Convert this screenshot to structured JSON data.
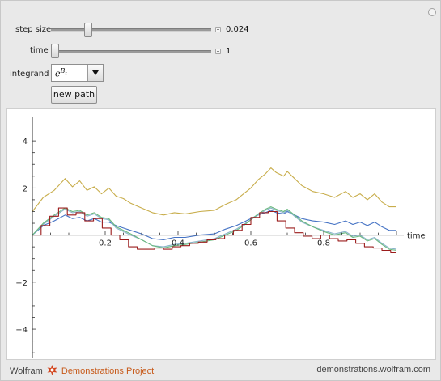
{
  "controls": {
    "step_size": {
      "label": "step size",
      "value": "0.024",
      "fraction": 0.22
    },
    "time": {
      "label": "time",
      "value": "1",
      "fraction": 0.0
    },
    "integrand": {
      "label": "integrand",
      "selected": "e^{B_t}",
      "base": "e",
      "sup": "B",
      "sub": "t"
    },
    "new_path_label": "new path"
  },
  "footer": {
    "brand": "Wolfram",
    "project": "Demonstrations Project",
    "url": "demonstrations.wolfram.com"
  },
  "chart_data": {
    "type": "line",
    "xlabel": "time",
    "ylabel": "",
    "xlim": [
      0,
      1.02
    ],
    "ylim": [
      -5.2,
      5.0
    ],
    "xticks": [
      0.2,
      0.4,
      0.6,
      0.8
    ],
    "yticks": [
      -4,
      -2,
      2,
      4
    ],
    "series": [
      {
        "color": "#c8ad4b",
        "step": false,
        "points": [
          [
            0,
            1.0
          ],
          [
            0.03,
            1.6
          ],
          [
            0.06,
            1.9
          ],
          [
            0.09,
            2.4
          ],
          [
            0.11,
            2.05
          ],
          [
            0.13,
            2.3
          ],
          [
            0.15,
            1.9
          ],
          [
            0.17,
            2.05
          ],
          [
            0.19,
            1.75
          ],
          [
            0.21,
            2.0
          ],
          [
            0.23,
            1.65
          ],
          [
            0.25,
            1.55
          ],
          [
            0.27,
            1.35
          ],
          [
            0.3,
            1.15
          ],
          [
            0.33,
            0.95
          ],
          [
            0.36,
            0.85
          ],
          [
            0.39,
            0.95
          ],
          [
            0.42,
            0.9
          ],
          [
            0.46,
            1.0
          ],
          [
            0.5,
            1.05
          ],
          [
            0.53,
            1.3
          ],
          [
            0.56,
            1.5
          ],
          [
            0.58,
            1.75
          ],
          [
            0.6,
            2.0
          ],
          [
            0.62,
            2.35
          ],
          [
            0.64,
            2.6
          ],
          [
            0.655,
            2.85
          ],
          [
            0.67,
            2.65
          ],
          [
            0.69,
            2.5
          ],
          [
            0.7,
            2.7
          ],
          [
            0.72,
            2.4
          ],
          [
            0.74,
            2.1
          ],
          [
            0.77,
            1.85
          ],
          [
            0.8,
            1.75
          ],
          [
            0.83,
            1.6
          ],
          [
            0.86,
            1.85
          ],
          [
            0.88,
            1.6
          ],
          [
            0.9,
            1.75
          ],
          [
            0.92,
            1.5
          ],
          [
            0.94,
            1.75
          ],
          [
            0.96,
            1.4
          ],
          [
            0.98,
            1.2
          ],
          [
            1.0,
            1.2
          ]
        ]
      },
      {
        "color": "#4472c4",
        "step": false,
        "points": [
          [
            0,
            0.0
          ],
          [
            0.03,
            0.4
          ],
          [
            0.06,
            0.6
          ],
          [
            0.09,
            0.85
          ],
          [
            0.11,
            0.7
          ],
          [
            0.13,
            0.75
          ],
          [
            0.15,
            0.6
          ],
          [
            0.17,
            0.7
          ],
          [
            0.19,
            0.55
          ],
          [
            0.21,
            0.55
          ],
          [
            0.23,
            0.4
          ],
          [
            0.25,
            0.3
          ],
          [
            0.27,
            0.2
          ],
          [
            0.3,
            0.05
          ],
          [
            0.33,
            -0.15
          ],
          [
            0.36,
            -0.2
          ],
          [
            0.39,
            -0.1
          ],
          [
            0.42,
            -0.1
          ],
          [
            0.46,
            0.0
          ],
          [
            0.5,
            0.05
          ],
          [
            0.53,
            0.25
          ],
          [
            0.56,
            0.4
          ],
          [
            0.58,
            0.55
          ],
          [
            0.6,
            0.7
          ],
          [
            0.62,
            0.85
          ],
          [
            0.64,
            0.95
          ],
          [
            0.655,
            1.05
          ],
          [
            0.67,
            0.95
          ],
          [
            0.69,
            0.9
          ],
          [
            0.7,
            1.0
          ],
          [
            0.72,
            0.85
          ],
          [
            0.74,
            0.7
          ],
          [
            0.77,
            0.6
          ],
          [
            0.8,
            0.55
          ],
          [
            0.83,
            0.45
          ],
          [
            0.86,
            0.6
          ],
          [
            0.88,
            0.45
          ],
          [
            0.9,
            0.55
          ],
          [
            0.92,
            0.4
          ],
          [
            0.94,
            0.55
          ],
          [
            0.96,
            0.35
          ],
          [
            0.98,
            0.2
          ],
          [
            1.0,
            0.2
          ]
        ]
      },
      {
        "color": "#8ab4cc",
        "step": false,
        "points": [
          [
            0,
            0.0
          ],
          [
            0.03,
            0.45
          ],
          [
            0.06,
            0.8
          ],
          [
            0.09,
            1.1
          ],
          [
            0.11,
            0.95
          ],
          [
            0.13,
            1.0
          ],
          [
            0.15,
            0.8
          ],
          [
            0.17,
            0.9
          ],
          [
            0.19,
            0.7
          ],
          [
            0.21,
            0.65
          ],
          [
            0.23,
            0.3
          ],
          [
            0.25,
            0.15
          ],
          [
            0.27,
            0.0
          ],
          [
            0.3,
            -0.2
          ],
          [
            0.33,
            -0.45
          ],
          [
            0.36,
            -0.5
          ],
          [
            0.39,
            -0.4
          ],
          [
            0.42,
            -0.35
          ],
          [
            0.46,
            -0.25
          ],
          [
            0.5,
            -0.15
          ],
          [
            0.53,
            0.05
          ],
          [
            0.56,
            0.25
          ],
          [
            0.58,
            0.45
          ],
          [
            0.6,
            0.65
          ],
          [
            0.62,
            0.85
          ],
          [
            0.64,
            1.05
          ],
          [
            0.655,
            1.15
          ],
          [
            0.67,
            1.05
          ],
          [
            0.69,
            0.95
          ],
          [
            0.7,
            1.05
          ],
          [
            0.72,
            0.8
          ],
          [
            0.74,
            0.55
          ],
          [
            0.77,
            0.35
          ],
          [
            0.8,
            0.2
          ],
          [
            0.83,
            0.05
          ],
          [
            0.86,
            0.15
          ],
          [
            0.88,
            -0.05
          ],
          [
            0.9,
            0.0
          ],
          [
            0.92,
            -0.2
          ],
          [
            0.94,
            -0.1
          ],
          [
            0.96,
            -0.35
          ],
          [
            0.98,
            -0.55
          ],
          [
            1.0,
            -0.6
          ]
        ]
      },
      {
        "color": "#6ab87e",
        "step": false,
        "points": [
          [
            0,
            0.0
          ],
          [
            0.03,
            0.5
          ],
          [
            0.06,
            0.85
          ],
          [
            0.09,
            1.15
          ],
          [
            0.11,
            1.0
          ],
          [
            0.13,
            1.05
          ],
          [
            0.15,
            0.85
          ],
          [
            0.17,
            0.95
          ],
          [
            0.19,
            0.75
          ],
          [
            0.21,
            0.7
          ],
          [
            0.23,
            0.35
          ],
          [
            0.25,
            0.2
          ],
          [
            0.27,
            0.05
          ],
          [
            0.3,
            -0.2
          ],
          [
            0.33,
            -0.45
          ],
          [
            0.36,
            -0.55
          ],
          [
            0.39,
            -0.45
          ],
          [
            0.42,
            -0.4
          ],
          [
            0.46,
            -0.3
          ],
          [
            0.5,
            -0.2
          ],
          [
            0.53,
            0.0
          ],
          [
            0.56,
            0.2
          ],
          [
            0.58,
            0.4
          ],
          [
            0.6,
            0.65
          ],
          [
            0.62,
            0.9
          ],
          [
            0.64,
            1.1
          ],
          [
            0.655,
            1.2
          ],
          [
            0.67,
            1.1
          ],
          [
            0.69,
            1.0
          ],
          [
            0.7,
            1.1
          ],
          [
            0.72,
            0.85
          ],
          [
            0.74,
            0.6
          ],
          [
            0.77,
            0.35
          ],
          [
            0.8,
            0.15
          ],
          [
            0.83,
            0.0
          ],
          [
            0.86,
            0.1
          ],
          [
            0.88,
            -0.1
          ],
          [
            0.9,
            -0.05
          ],
          [
            0.92,
            -0.25
          ],
          [
            0.94,
            -0.15
          ],
          [
            0.96,
            -0.4
          ],
          [
            0.98,
            -0.6
          ],
          [
            1.0,
            -0.65
          ]
        ]
      },
      {
        "color": "#9b1c1c",
        "step": true,
        "points": [
          [
            0,
            0.0
          ],
          [
            0.024,
            0.4
          ],
          [
            0.048,
            0.8
          ],
          [
            0.072,
            1.15
          ],
          [
            0.096,
            0.85
          ],
          [
            0.12,
            0.95
          ],
          [
            0.144,
            0.6
          ],
          [
            0.168,
            0.7
          ],
          [
            0.192,
            0.3
          ],
          [
            0.216,
            0.0
          ],
          [
            0.24,
            -0.2
          ],
          [
            0.264,
            -0.5
          ],
          [
            0.288,
            -0.6
          ],
          [
            0.312,
            -0.6
          ],
          [
            0.336,
            -0.55
          ],
          [
            0.36,
            -0.6
          ],
          [
            0.384,
            -0.5
          ],
          [
            0.408,
            -0.45
          ],
          [
            0.432,
            -0.35
          ],
          [
            0.456,
            -0.3
          ],
          [
            0.48,
            -0.2
          ],
          [
            0.504,
            -0.15
          ],
          [
            0.528,
            0.0
          ],
          [
            0.552,
            0.2
          ],
          [
            0.576,
            0.45
          ],
          [
            0.6,
            0.75
          ],
          [
            0.624,
            0.95
          ],
          [
            0.648,
            1.0
          ],
          [
            0.672,
            0.6
          ],
          [
            0.696,
            0.3
          ],
          [
            0.72,
            0.1
          ],
          [
            0.744,
            -0.05
          ],
          [
            0.768,
            -0.15
          ],
          [
            0.792,
            0.0
          ],
          [
            0.816,
            -0.15
          ],
          [
            0.84,
            -0.25
          ],
          [
            0.864,
            -0.2
          ],
          [
            0.888,
            -0.35
          ],
          [
            0.912,
            -0.5
          ],
          [
            0.936,
            -0.55
          ],
          [
            0.96,
            -0.65
          ],
          [
            0.984,
            -0.75
          ],
          [
            1.0,
            -0.75
          ]
        ]
      }
    ]
  }
}
